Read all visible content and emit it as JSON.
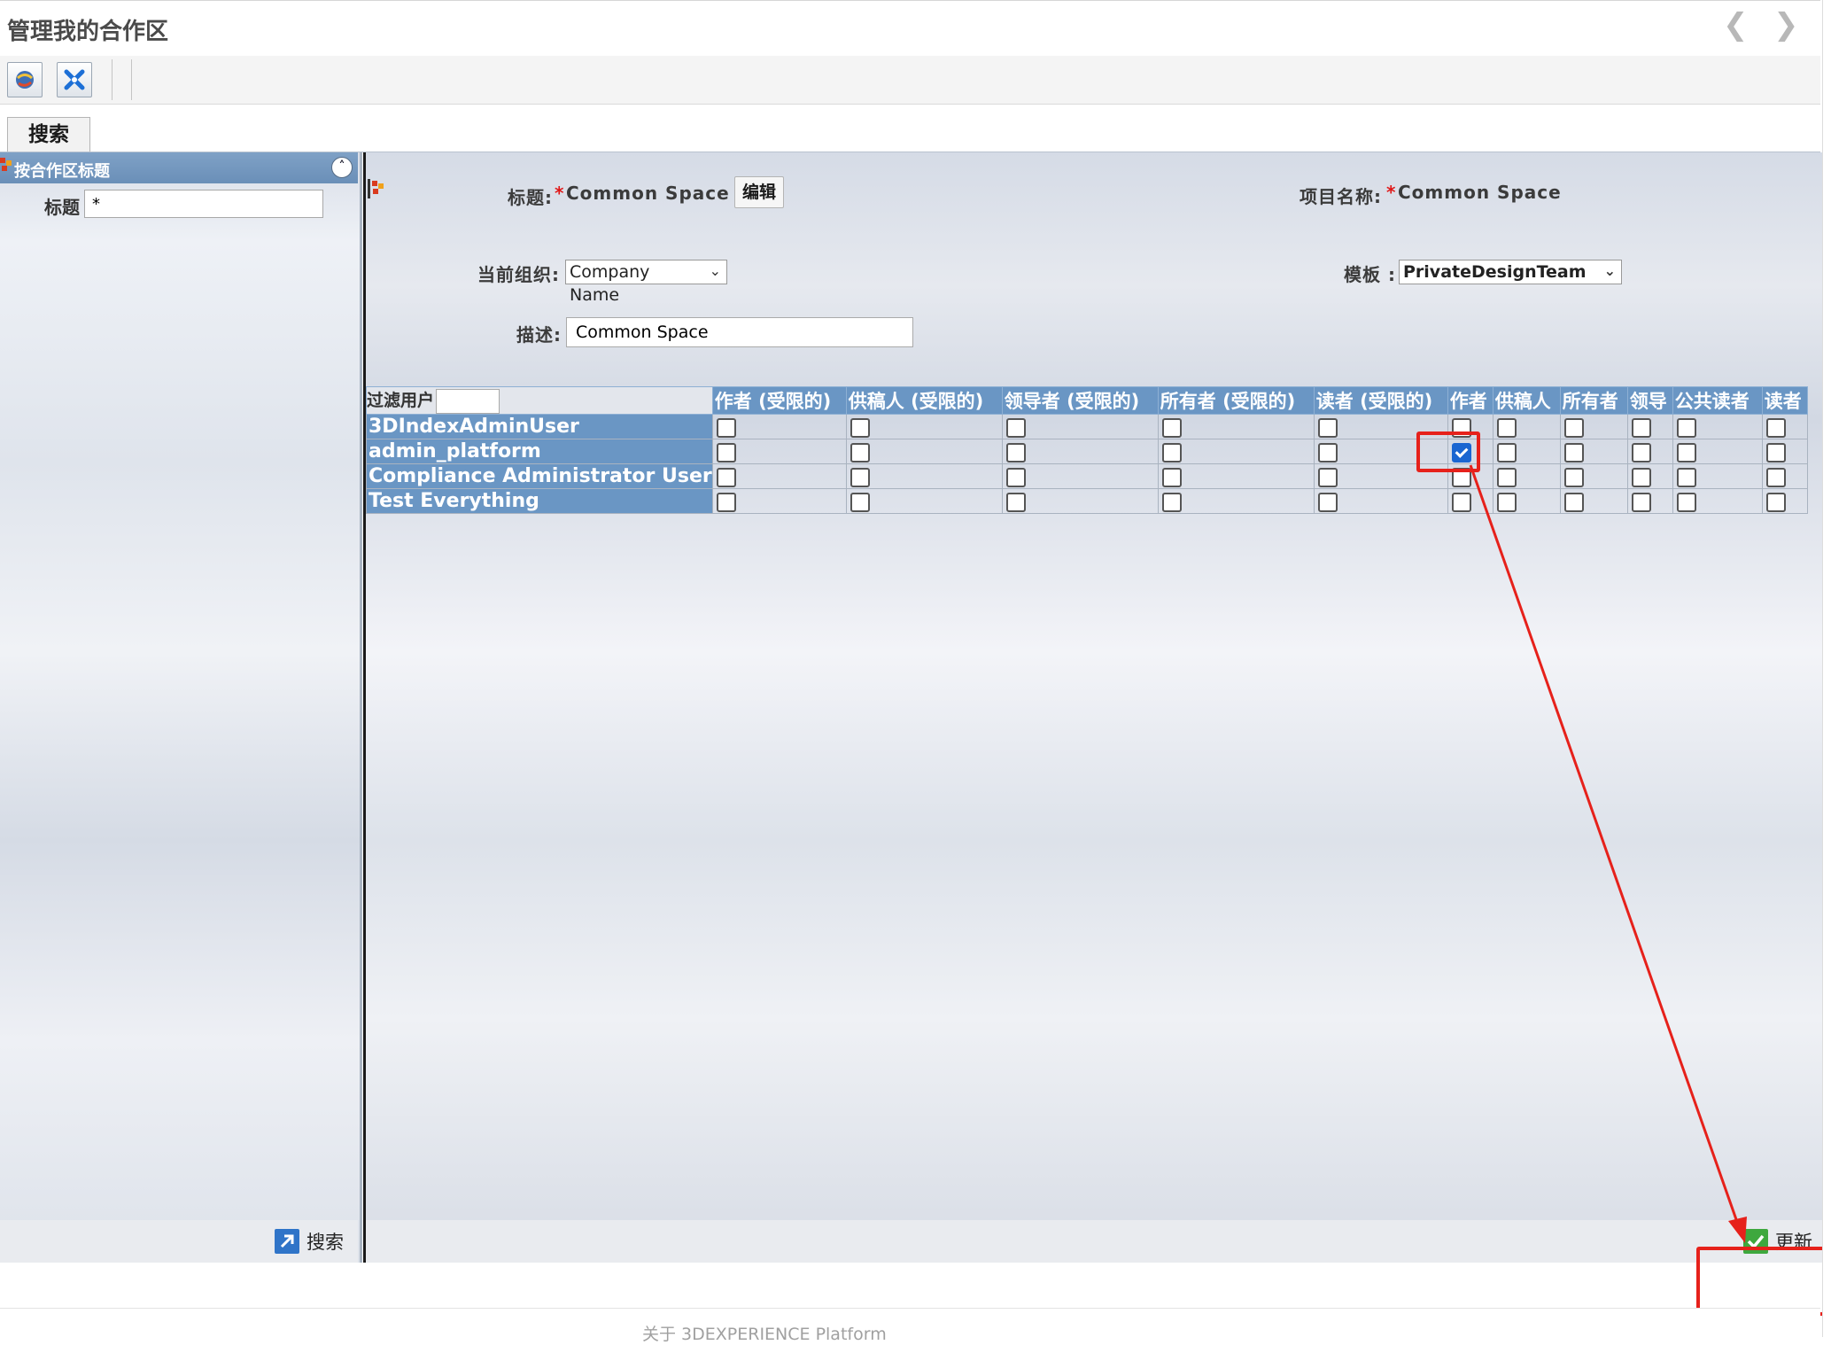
{
  "window": {
    "title": "管理我的合作区"
  },
  "nav": {
    "back_icon": "chevron-left-icon",
    "forward_icon": "chevron-right-icon"
  },
  "toolbar": {
    "buttons": [
      {
        "icon": "refresh-globe-icon"
      },
      {
        "icon": "tools-icon"
      }
    ]
  },
  "tabs": [
    {
      "label": "搜索",
      "active": true
    }
  ],
  "search_panel": {
    "section_title": "按合作区标题",
    "title_label": "标题",
    "title_value": "*",
    "search_button": "搜索"
  },
  "form": {
    "title_label": "标题:",
    "required_mark": "*",
    "title_value": "Common Space",
    "edit_button": "编辑",
    "project_label": "项目名称:",
    "project_value": "Common Space",
    "org_label": "当前组织:",
    "org_value": "Company Name",
    "template_label": "模板 :",
    "template_value": "PrivateDesignTeam",
    "desc_label": "描述:",
    "desc_value": "Common Space"
  },
  "table": {
    "filter_label": "过滤用户",
    "columns": [
      "作者 (受限的)",
      "供稿人 (受限的)",
      "领导者 (受限的)",
      "所有者 (受限的)",
      "读者 (受限的)",
      "作者",
      "供稿人",
      "所有者",
      "领导",
      "公共读者",
      "读者"
    ],
    "rows": [
      {
        "user": "3DIndexAdminUser",
        "checks": [
          false,
          false,
          false,
          false,
          false,
          false,
          false,
          false,
          false,
          false,
          false
        ]
      },
      {
        "user": "admin_platform",
        "checks": [
          false,
          false,
          false,
          false,
          false,
          true,
          false,
          false,
          false,
          false,
          false
        ]
      },
      {
        "user": "Compliance Administrator User",
        "checks": [
          false,
          false,
          false,
          false,
          false,
          false,
          false,
          false,
          false,
          false,
          false
        ]
      },
      {
        "user": "Test Everything",
        "checks": [
          false,
          false,
          false,
          false,
          false,
          false,
          false,
          false,
          false,
          false,
          false
        ]
      }
    ]
  },
  "footer": {
    "update_button": "更新",
    "about_text": "关于 3DEXPERIENCE Platform"
  },
  "colors": {
    "header_blue": "#6a96c4",
    "annotation_red": "#e6211b",
    "checked_blue": "#1a66d1"
  }
}
